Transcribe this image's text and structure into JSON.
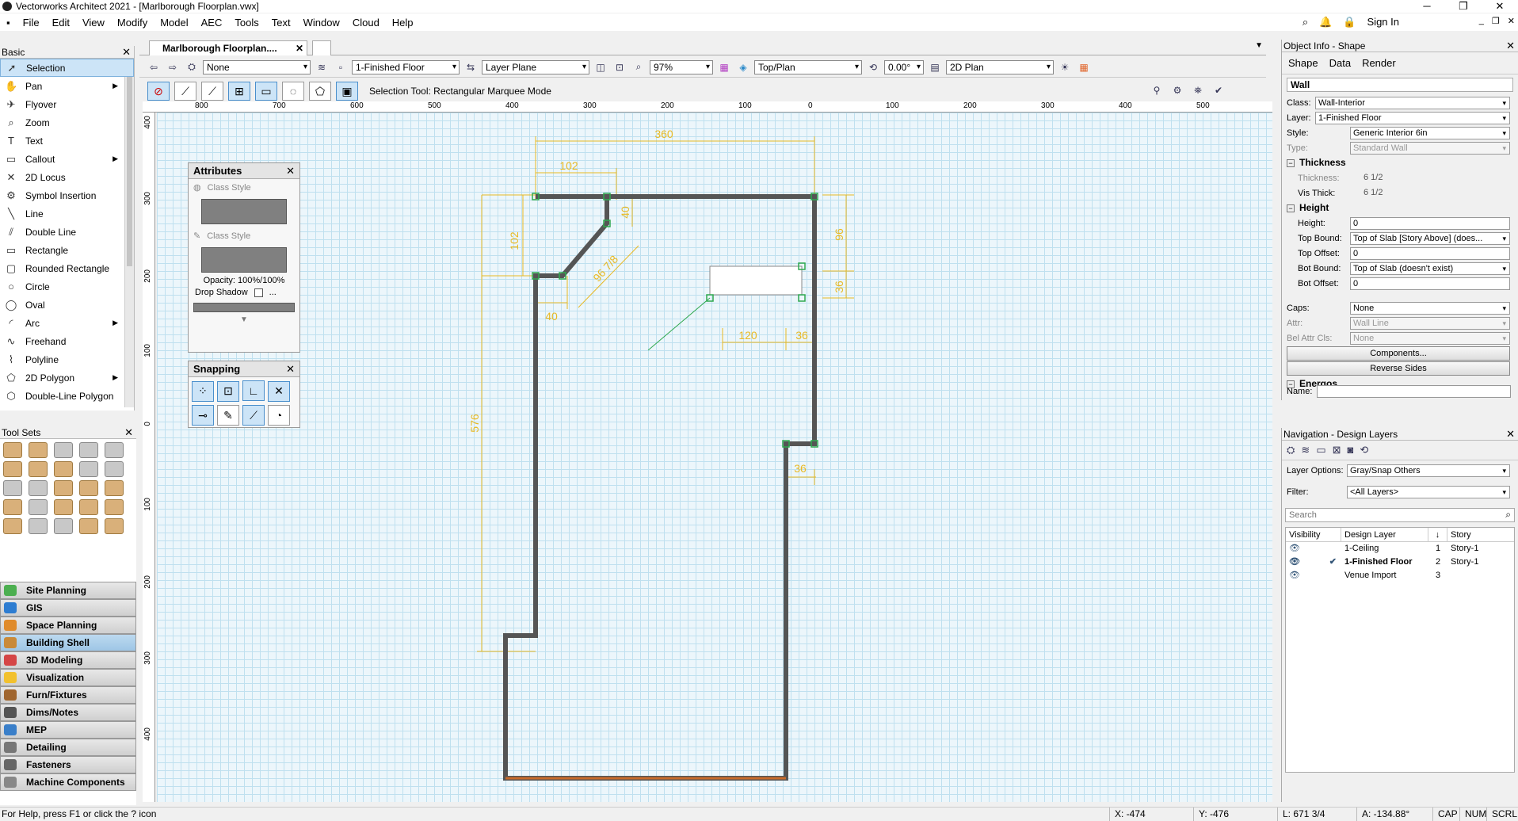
{
  "app": {
    "title": "Vectorworks Architect 2021 - [Marlborough Floorplan.vwx]"
  },
  "menu": [
    "File",
    "Edit",
    "View",
    "Modify",
    "Model",
    "AEC",
    "Tools",
    "Text",
    "Window",
    "Cloud",
    "Help"
  ],
  "account": {
    "sign_in": "Sign In"
  },
  "basic_palette": {
    "title": "Basic",
    "tools": [
      "Selection",
      "Pan",
      "Flyover",
      "Zoom",
      "Text",
      "Callout",
      "2D Locus",
      "Symbol Insertion",
      "Line",
      "Double Line",
      "Rectangle",
      "Rounded Rectangle",
      "Circle",
      "Oval",
      "Arc",
      "Freehand",
      "Polyline",
      "2D Polygon",
      "Double-Line Polygon"
    ]
  },
  "tool_sets": {
    "title": "Tool Sets",
    "categories": [
      "Site Planning",
      "GIS",
      "Space Planning",
      "Building Shell",
      "3D Modeling",
      "Visualization",
      "Furn/Fixtures",
      "Dims/Notes",
      "MEP",
      "Detailing",
      "Fasteners",
      "Machine Components"
    ],
    "selected": "Building Shell"
  },
  "document": {
    "tab": "Marlborough Floorplan...."
  },
  "view_bar": {
    "class": "None",
    "layer": "1-Finished Floor",
    "plane": "Layer Plane",
    "zoom": "97%",
    "view": "Top/Plan",
    "rotation": "0.00°",
    "render": "2D Plan"
  },
  "mode_bar": {
    "hint": "Selection Tool: Rectangular Marquee Mode"
  },
  "ruler": {
    "h": [
      "800",
      "700",
      "600",
      "500",
      "400",
      "300",
      "200",
      "100",
      "0",
      "100",
      "200",
      "300",
      "400",
      "500"
    ],
    "v": [
      "400",
      "300",
      "200",
      "100",
      "0",
      "100",
      "200",
      "300",
      "400"
    ]
  },
  "dimensions": [
    "360",
    "102",
    "102",
    "40",
    "96 7/8",
    "40",
    "96",
    "36",
    "120",
    "36",
    "576",
    "36"
  ],
  "attributes_palette": {
    "title": "Attributes",
    "fill_label": "Class Style",
    "pen_label": "Class Style",
    "opacity": "Opacity: 100%/100%",
    "drop_shadow": "Drop Shadow",
    "more": "..."
  },
  "snapping_palette": {
    "title": "Snapping"
  },
  "object_info": {
    "title": "Object Info - Shape",
    "tabs": [
      "Shape",
      "Data",
      "Render"
    ],
    "object_type": "Wall",
    "class_label": "Class:",
    "class_value": "Wall-Interior",
    "layer_label": "Layer:",
    "layer_value": "1-Finished Floor",
    "style_label": "Style:",
    "style_value": "Generic Interior 6in",
    "type_label": "Type:",
    "type_value": "Standard Wall",
    "thickness_section": "Thickness",
    "thickness_label": "Thickness:",
    "thickness_value": "6 1/2",
    "visthick_label": "Vis Thick:",
    "visthick_value": "6 1/2",
    "height_section": "Height",
    "height_label": "Height:",
    "height_value": "0",
    "topbound_label": "Top Bound:",
    "topbound_value": "Top of Slab [Story Above] (does...",
    "topoffset_label": "Top Offset:",
    "topoffset_value": "0",
    "botbound_label": "Bot Bound:",
    "botbound_value": "Top of Slab (doesn't exist)",
    "botoffset_label": "Bot Offset:",
    "botoffset_value": "0",
    "caps_label": "Caps:",
    "caps_value": "None",
    "attr_label": "Attr:",
    "attr_value": "Wall Line",
    "belattr_label": "Bel Attr Cls:",
    "belattr_value": "None",
    "components_btn": "Components...",
    "reverse_btn": "Reverse Sides",
    "energos_section": "Energos",
    "name_label": "Name:"
  },
  "navigation": {
    "title": "Navigation - Design Layers",
    "layer_options_label": "Layer Options:",
    "layer_options_value": "Gray/Snap Others",
    "filter_label": "Filter:",
    "filter_value": "<All Layers>",
    "search_placeholder": "Search",
    "columns": [
      "Visibility",
      "Design Layer",
      "↓",
      "Story"
    ],
    "rows": [
      {
        "name": "1-Ceiling",
        "num": "1",
        "story": "Story-1",
        "active": ""
      },
      {
        "name": "1-Finished Floor",
        "num": "2",
        "story": "Story-1",
        "active": "✔"
      },
      {
        "name": "Venue Import",
        "num": "3",
        "story": "",
        "active": ""
      }
    ]
  },
  "status": {
    "help": "For Help, press F1 or click the ? icon",
    "x": "X: -474",
    "y": "Y: -476",
    "l": "L: 671 3/4",
    "a": "A: -134.88°",
    "caps": "CAP",
    "num": "NUM",
    "scrl": "SCRL"
  },
  "colors": {
    "dimension": "#e8b923",
    "wall": "#555555",
    "selection_handle": "#2fa84f",
    "grid_bg": "#ecf6fb"
  }
}
